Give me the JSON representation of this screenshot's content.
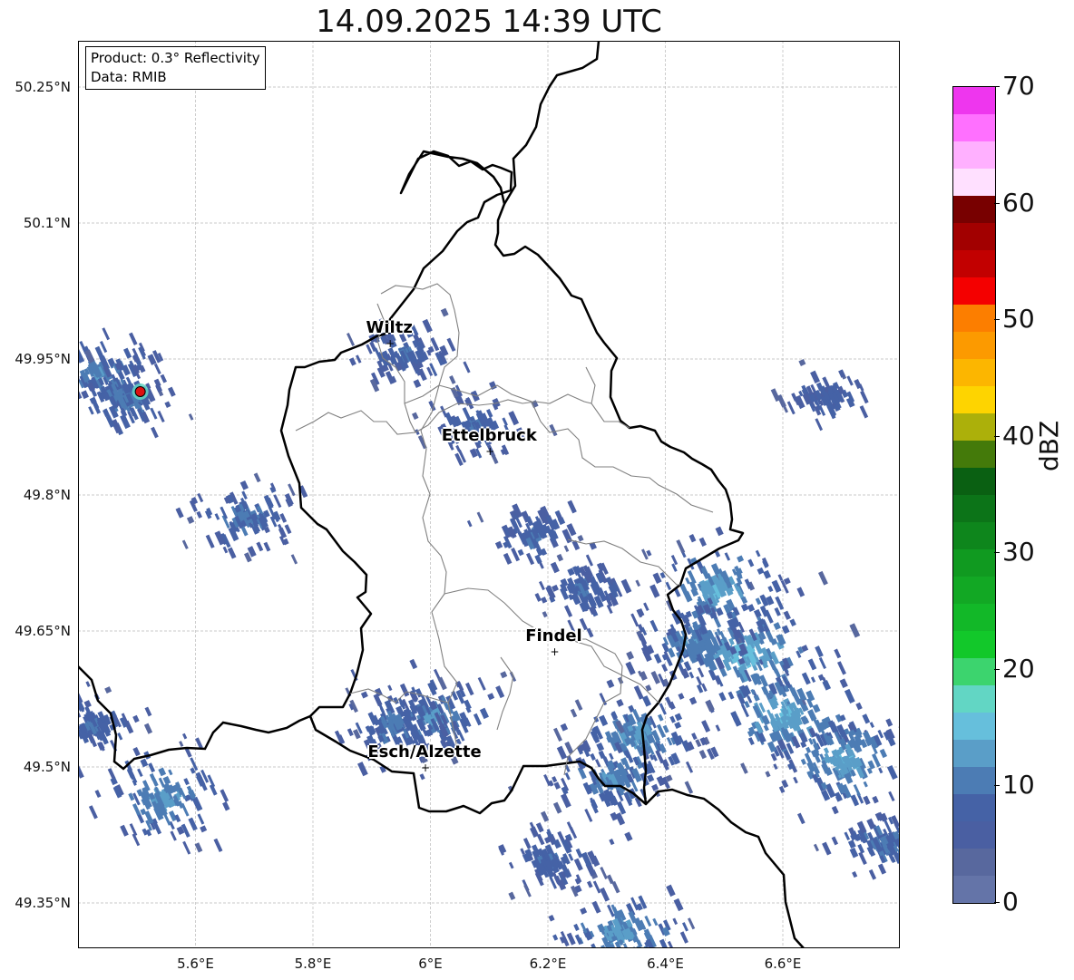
{
  "title": "14.09.2025 14:39 UTC",
  "info": {
    "product": "Product: 0.3° Reflectivity",
    "data_source": "Data: RMIB"
  },
  "y_ticks": [
    {
      "value": 50.25,
      "label": "50.25°N"
    },
    {
      "value": 50.1,
      "label": "50.1°N"
    },
    {
      "value": 49.95,
      "label": "49.95°N"
    },
    {
      "value": 49.8,
      "label": "49.8°N"
    },
    {
      "value": 49.65,
      "label": "49.65°N"
    },
    {
      "value": 49.5,
      "label": "49.5°N"
    },
    {
      "value": 49.35,
      "label": "49.35°N"
    }
  ],
  "x_ticks": [
    {
      "value": 5.6,
      "label": "5.6°E"
    },
    {
      "value": 5.8,
      "label": "5.8°E"
    },
    {
      "value": 6.0,
      "label": "6°E"
    },
    {
      "value": 6.2,
      "label": "6.2°E"
    },
    {
      "value": 6.4,
      "label": "6.4°E"
    },
    {
      "value": 6.6,
      "label": "6.6°E"
    }
  ],
  "extent": {
    "lon": [
      5.4,
      6.8
    ],
    "lat": [
      49.3,
      50.3
    ]
  },
  "cities": [
    {
      "name": "Wiltz",
      "lon": 5.93,
      "lat": 49.967
    },
    {
      "name": "Ettelbruck",
      "lon": 6.1,
      "lat": 49.848
    },
    {
      "name": "Findel",
      "lon": 6.21,
      "lat": 49.627
    },
    {
      "name": "Esch/Alzette",
      "lon": 5.99,
      "lat": 49.499
    }
  ],
  "radar_site": {
    "lon": 5.506,
    "lat": 49.914,
    "color": "#dd1111"
  },
  "colorbar": {
    "label": "dBZ",
    "min": 0,
    "max": 70,
    "ticks": [
      {
        "value": 0,
        "label": "0"
      },
      {
        "value": 10,
        "label": "10"
      },
      {
        "value": 20,
        "label": "20"
      },
      {
        "value": 30,
        "label": "30"
      },
      {
        "value": 40,
        "label": "40"
      },
      {
        "value": 50,
        "label": "50"
      },
      {
        "value": 60,
        "label": "60"
      },
      {
        "value": 70,
        "label": "70"
      }
    ],
    "colors": [
      "#6474a8",
      "#58689e",
      "#4a5fa2",
      "#4562a6",
      "#4c7cb4",
      "#5a9ec8",
      "#66bfdc",
      "#62d6c4",
      "#3cd46e",
      "#12c82a",
      "#12b828",
      "#12a824",
      "#109a20",
      "#0e861c",
      "#0c7418",
      "#0a6012",
      "#447a0a",
      "#acb00a",
      "#fed400",
      "#fcb600",
      "#fc9a00",
      "#fc7e00",
      "#f40000",
      "#c20000",
      "#a20000",
      "#780000",
      "#ffe0ff",
      "#ffb0ff",
      "#ff70ff",
      "#ee36ee"
    ]
  },
  "rain_cells": [
    {
      "lon": 6.53,
      "lat": 49.63,
      "intensity": 0.9
    },
    {
      "lon": 6.48,
      "lat": 49.7,
      "intensity": 0.8
    },
    {
      "lon": 6.6,
      "lat": 49.56,
      "intensity": 0.85
    },
    {
      "lon": 6.7,
      "lat": 49.51,
      "intensity": 0.8
    },
    {
      "lon": 6.44,
      "lat": 49.64,
      "intensity": 0.6
    },
    {
      "lon": 6.35,
      "lat": 49.54,
      "intensity": 0.7
    },
    {
      "lon": 6.3,
      "lat": 49.49,
      "intensity": 0.6
    },
    {
      "lon": 6.77,
      "lat": 49.42,
      "intensity": 0.5
    },
    {
      "lon": 6.32,
      "lat": 49.32,
      "intensity": 0.7
    },
    {
      "lon": 6.0,
      "lat": 49.56,
      "intensity": 0.6
    },
    {
      "lon": 5.93,
      "lat": 49.55,
      "intensity": 0.5
    },
    {
      "lon": 5.54,
      "lat": 49.47,
      "intensity": 0.7
    },
    {
      "lon": 5.43,
      "lat": 49.94,
      "intensity": 0.6
    },
    {
      "lon": 5.47,
      "lat": 49.91,
      "intensity": 0.5
    },
    {
      "lon": 5.68,
      "lat": 49.78,
      "intensity": 0.5
    },
    {
      "lon": 6.17,
      "lat": 49.76,
      "intensity": 0.4
    },
    {
      "lon": 6.25,
      "lat": 49.7,
      "intensity": 0.4
    },
    {
      "lon": 6.07,
      "lat": 49.88,
      "intensity": 0.4
    },
    {
      "lon": 5.95,
      "lat": 49.96,
      "intensity": 0.4
    },
    {
      "lon": 6.67,
      "lat": 49.91,
      "intensity": 0.3
    },
    {
      "lon": 6.2,
      "lat": 49.4,
      "intensity": 0.4
    },
    {
      "lon": 5.42,
      "lat": 49.55,
      "intensity": 0.4
    }
  ]
}
